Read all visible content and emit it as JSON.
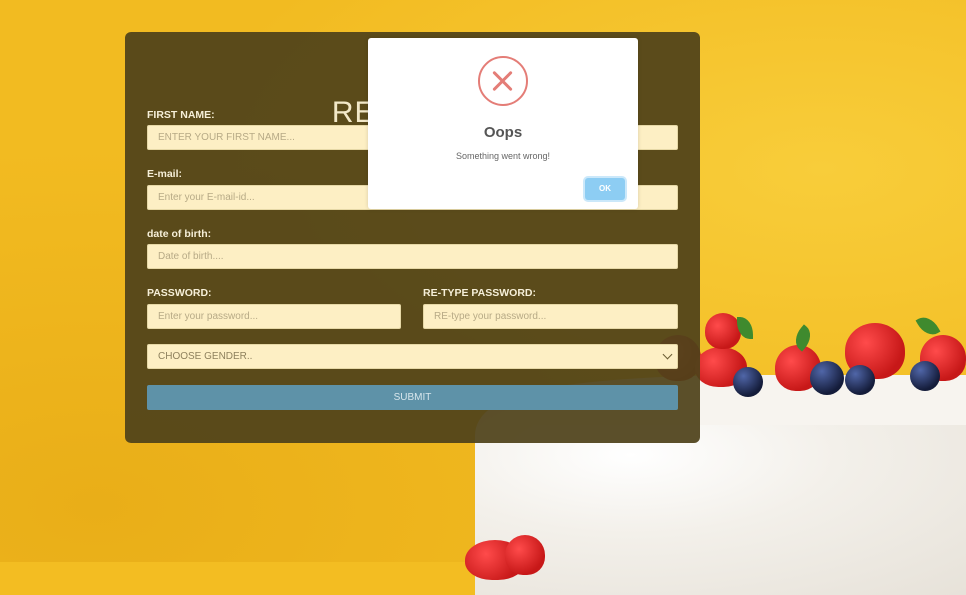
{
  "form": {
    "title": "REGISTER",
    "first_name_label": "FIRST NAME:",
    "first_name_placeholder": "ENTER YOUR FIRST NAME...",
    "email_label": "E-mail:",
    "email_placeholder": "Enter your E-mail-id...",
    "dob_label": "date of birth:",
    "dob_placeholder": "Date of birth....",
    "password_label": "PASSWORD:",
    "password_placeholder": "Enter your password...",
    "retype_label": "RE-TYPE PASSWORD:",
    "retype_placeholder": "RE-type your password...",
    "gender_select": "CHOOSE GENDER..",
    "submit_label": "SUBMIT"
  },
  "modal": {
    "title": "Oops",
    "message": "Something went wrong!",
    "ok_label": "OK",
    "icon": "error-x-icon"
  },
  "colors": {
    "background": "#f2bb21",
    "panel": "#4f421a",
    "input": "#fdefc4",
    "submit": "#5e92a8",
    "error": "#e47d77",
    "ok_button": "#8dcdf3"
  }
}
